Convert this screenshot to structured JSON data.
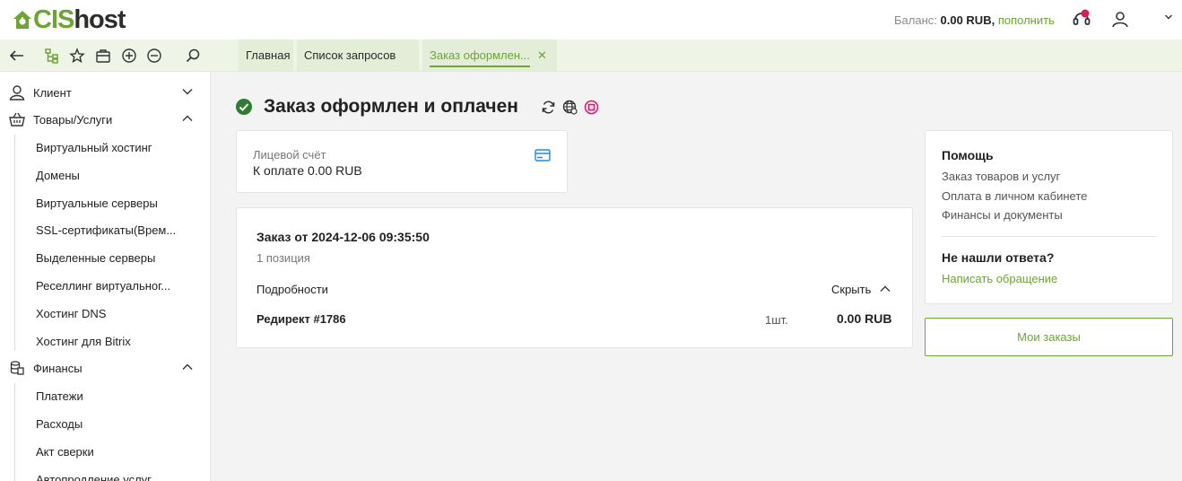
{
  "brand": {
    "logo_cis": "CIS",
    "logo_host": "host",
    "accent_color": "#6da534"
  },
  "header": {
    "balance_label": "Баланс:",
    "balance_value": "0.00 RUB,",
    "topup_label": "пополнить",
    "icons": [
      "support-icon",
      "user-icon",
      "chevron-down-icon"
    ]
  },
  "toolbar": {
    "icons": [
      "back-icon",
      "tree-icon",
      "star-icon",
      "briefcase-icon",
      "zoom-in-icon",
      "zoom-out-icon",
      "search-icon"
    ],
    "tabs": [
      {
        "label": "Главная"
      },
      {
        "label": "Список запросов"
      },
      {
        "label": "Заказ оформлен...",
        "close": "✕"
      }
    ]
  },
  "sidebar": {
    "sections": [
      {
        "label": "Клиент",
        "icon": "client-icon",
        "expanded": false
      },
      {
        "label": "Товары/Услуги",
        "icon": "basket-icon",
        "expanded": true,
        "items": [
          "Виртуальный хостинг",
          "Домены",
          "Виртуальные серверы",
          "SSL-сертификаты(Врем...",
          "Выделенные серверы",
          "Реселлинг виртуальног...",
          "Хостинг DNS",
          "Хостинг для Bitrix"
        ]
      },
      {
        "label": "Финансы",
        "icon": "finance-icon",
        "expanded": true,
        "items": [
          "Платежи",
          "Расходы",
          "Акт сверки",
          "Автопродление услуг"
        ]
      }
    ]
  },
  "main": {
    "title": "Заказ оформлен и оплачен",
    "account": {
      "label": "Лицевой счёт",
      "value": "К оплате 0.00 RUB"
    },
    "order": {
      "title": "Заказ от 2024-12-06 09:35:50",
      "count": "1 позиция",
      "details_label": "Подробности",
      "hide_label": "Скрыть",
      "item": {
        "name": "Редирект #1786",
        "qty": "1шт.",
        "price": "0.00 RUB"
      }
    }
  },
  "help": {
    "title": "Помощь",
    "links": [
      "Заказ товаров и услуг",
      "Оплата в личном кабинете",
      "Финансы и документы"
    ],
    "question": "Не нашли ответа?",
    "write_link": "Написать обращение",
    "my_orders_button": "Мои заказы"
  }
}
